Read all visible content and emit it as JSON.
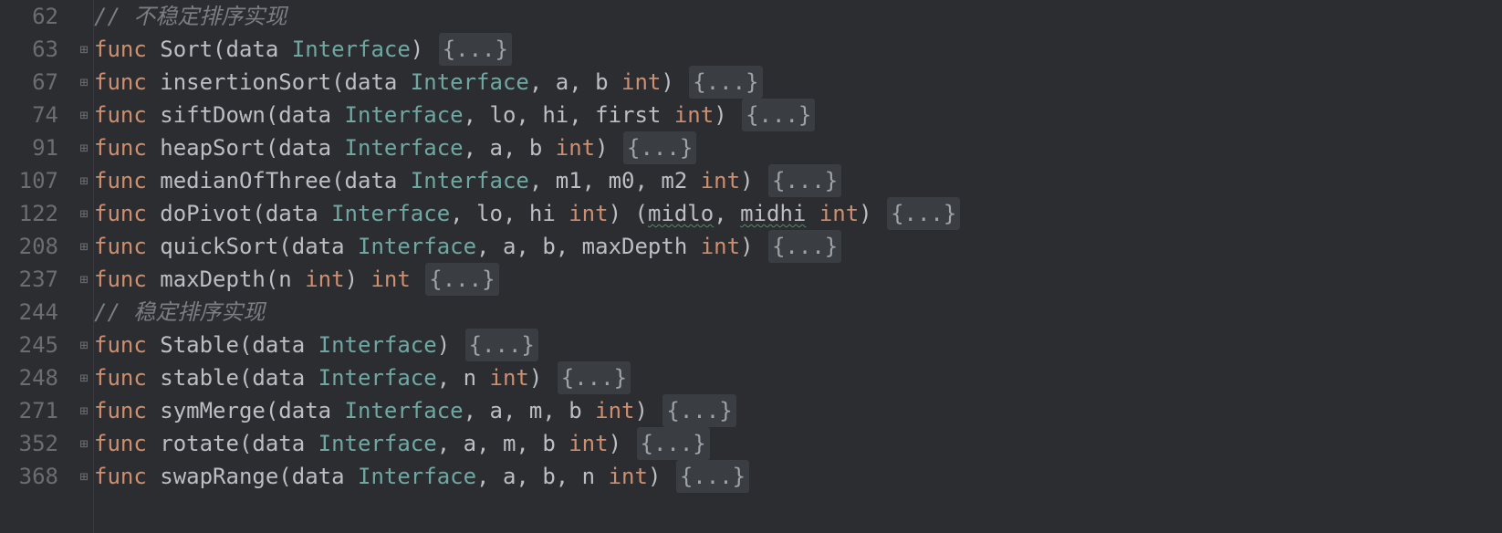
{
  "lines": [
    {
      "num": "62",
      "fold": "",
      "tokens": [
        {
          "cls": "tok-comment",
          "text": "// 不稳定排序实现"
        }
      ]
    },
    {
      "num": "63",
      "fold": "⊞",
      "tokens": [
        {
          "cls": "tok-keyword",
          "text": "func"
        },
        {
          "cls": "tok-default",
          "text": " "
        },
        {
          "cls": "tok-func-name",
          "text": "Sort"
        },
        {
          "cls": "tok-punct",
          "text": "("
        },
        {
          "cls": "tok-param",
          "text": "data"
        },
        {
          "cls": "tok-default",
          "text": " "
        },
        {
          "cls": "tok-type",
          "text": "Interface"
        },
        {
          "cls": "tok-punct",
          "text": ") "
        },
        {
          "cls": "fold-placeholder",
          "text": "{...}"
        }
      ]
    },
    {
      "num": "67",
      "fold": "⊞",
      "tokens": [
        {
          "cls": "tok-keyword",
          "text": "func"
        },
        {
          "cls": "tok-default",
          "text": " "
        },
        {
          "cls": "tok-func-name",
          "text": "insertionSort"
        },
        {
          "cls": "tok-punct",
          "text": "("
        },
        {
          "cls": "tok-param",
          "text": "data"
        },
        {
          "cls": "tok-default",
          "text": " "
        },
        {
          "cls": "tok-type",
          "text": "Interface"
        },
        {
          "cls": "tok-punct",
          "text": ", "
        },
        {
          "cls": "tok-param",
          "text": "a"
        },
        {
          "cls": "tok-punct",
          "text": ", "
        },
        {
          "cls": "tok-param",
          "text": "b"
        },
        {
          "cls": "tok-default",
          "text": " "
        },
        {
          "cls": "tok-keyword",
          "text": "int"
        },
        {
          "cls": "tok-punct",
          "text": ") "
        },
        {
          "cls": "fold-placeholder",
          "text": "{...}"
        }
      ]
    },
    {
      "num": "74",
      "fold": "⊞",
      "tokens": [
        {
          "cls": "tok-keyword",
          "text": "func"
        },
        {
          "cls": "tok-default",
          "text": " "
        },
        {
          "cls": "tok-func-name",
          "text": "siftDown"
        },
        {
          "cls": "tok-punct",
          "text": "("
        },
        {
          "cls": "tok-param",
          "text": "data"
        },
        {
          "cls": "tok-default",
          "text": " "
        },
        {
          "cls": "tok-type",
          "text": "Interface"
        },
        {
          "cls": "tok-punct",
          "text": ", "
        },
        {
          "cls": "tok-param",
          "text": "lo"
        },
        {
          "cls": "tok-punct",
          "text": ", "
        },
        {
          "cls": "tok-param",
          "text": "hi"
        },
        {
          "cls": "tok-punct",
          "text": ", "
        },
        {
          "cls": "tok-param",
          "text": "first"
        },
        {
          "cls": "tok-default",
          "text": " "
        },
        {
          "cls": "tok-keyword",
          "text": "int"
        },
        {
          "cls": "tok-punct",
          "text": ") "
        },
        {
          "cls": "fold-placeholder",
          "text": "{...}"
        }
      ]
    },
    {
      "num": "91",
      "fold": "⊞",
      "tokens": [
        {
          "cls": "tok-keyword",
          "text": "func"
        },
        {
          "cls": "tok-default",
          "text": " "
        },
        {
          "cls": "tok-func-name",
          "text": "heapSort"
        },
        {
          "cls": "tok-punct",
          "text": "("
        },
        {
          "cls": "tok-param",
          "text": "data"
        },
        {
          "cls": "tok-default",
          "text": " "
        },
        {
          "cls": "tok-type",
          "text": "Interface"
        },
        {
          "cls": "tok-punct",
          "text": ", "
        },
        {
          "cls": "tok-param",
          "text": "a"
        },
        {
          "cls": "tok-punct",
          "text": ", "
        },
        {
          "cls": "tok-param",
          "text": "b"
        },
        {
          "cls": "tok-default",
          "text": " "
        },
        {
          "cls": "tok-keyword",
          "text": "int"
        },
        {
          "cls": "tok-punct",
          "text": ") "
        },
        {
          "cls": "fold-placeholder",
          "text": "{...}"
        }
      ]
    },
    {
      "num": "107",
      "fold": "⊞",
      "tokens": [
        {
          "cls": "tok-keyword",
          "text": "func"
        },
        {
          "cls": "tok-default",
          "text": " "
        },
        {
          "cls": "tok-func-name",
          "text": "medianOfThree"
        },
        {
          "cls": "tok-punct",
          "text": "("
        },
        {
          "cls": "tok-param",
          "text": "data"
        },
        {
          "cls": "tok-default",
          "text": " "
        },
        {
          "cls": "tok-type",
          "text": "Interface"
        },
        {
          "cls": "tok-punct",
          "text": ", "
        },
        {
          "cls": "tok-param",
          "text": "m1"
        },
        {
          "cls": "tok-punct",
          "text": ", "
        },
        {
          "cls": "tok-param",
          "text": "m0"
        },
        {
          "cls": "tok-punct",
          "text": ", "
        },
        {
          "cls": "tok-param",
          "text": "m2"
        },
        {
          "cls": "tok-default",
          "text": " "
        },
        {
          "cls": "tok-keyword",
          "text": "int"
        },
        {
          "cls": "tok-punct",
          "text": ") "
        },
        {
          "cls": "fold-placeholder",
          "text": "{...}"
        }
      ]
    },
    {
      "num": "122",
      "fold": "⊞",
      "tokens": [
        {
          "cls": "tok-keyword",
          "text": "func"
        },
        {
          "cls": "tok-default",
          "text": " "
        },
        {
          "cls": "tok-func-name",
          "text": "doPivot"
        },
        {
          "cls": "tok-punct",
          "text": "("
        },
        {
          "cls": "tok-param",
          "text": "data"
        },
        {
          "cls": "tok-default",
          "text": " "
        },
        {
          "cls": "tok-type",
          "text": "Interface"
        },
        {
          "cls": "tok-punct",
          "text": ", "
        },
        {
          "cls": "tok-param",
          "text": "lo"
        },
        {
          "cls": "tok-punct",
          "text": ", "
        },
        {
          "cls": "tok-param",
          "text": "hi"
        },
        {
          "cls": "tok-default",
          "text": " "
        },
        {
          "cls": "tok-keyword",
          "text": "int"
        },
        {
          "cls": "tok-punct",
          "text": ") ("
        },
        {
          "cls": "tok-named-return",
          "text": "midlo"
        },
        {
          "cls": "tok-punct",
          "text": ", "
        },
        {
          "cls": "tok-named-return",
          "text": "midhi"
        },
        {
          "cls": "tok-default",
          "text": " "
        },
        {
          "cls": "tok-keyword",
          "text": "int"
        },
        {
          "cls": "tok-punct",
          "text": ") "
        },
        {
          "cls": "fold-placeholder",
          "text": "{...}"
        }
      ]
    },
    {
      "num": "208",
      "fold": "⊞",
      "tokens": [
        {
          "cls": "tok-keyword",
          "text": "func"
        },
        {
          "cls": "tok-default",
          "text": " "
        },
        {
          "cls": "tok-func-name",
          "text": "quickSort"
        },
        {
          "cls": "tok-punct",
          "text": "("
        },
        {
          "cls": "tok-param",
          "text": "data"
        },
        {
          "cls": "tok-default",
          "text": " "
        },
        {
          "cls": "tok-type",
          "text": "Interface"
        },
        {
          "cls": "tok-punct",
          "text": ", "
        },
        {
          "cls": "tok-param",
          "text": "a"
        },
        {
          "cls": "tok-punct",
          "text": ", "
        },
        {
          "cls": "tok-param",
          "text": "b"
        },
        {
          "cls": "tok-punct",
          "text": ", "
        },
        {
          "cls": "tok-param",
          "text": "maxDepth"
        },
        {
          "cls": "tok-default",
          "text": " "
        },
        {
          "cls": "tok-keyword",
          "text": "int"
        },
        {
          "cls": "tok-punct",
          "text": ") "
        },
        {
          "cls": "fold-placeholder",
          "text": "{...}"
        }
      ]
    },
    {
      "num": "237",
      "fold": "⊞",
      "tokens": [
        {
          "cls": "tok-keyword",
          "text": "func"
        },
        {
          "cls": "tok-default",
          "text": " "
        },
        {
          "cls": "tok-func-name",
          "text": "maxDepth"
        },
        {
          "cls": "tok-punct",
          "text": "("
        },
        {
          "cls": "tok-param",
          "text": "n"
        },
        {
          "cls": "tok-default",
          "text": " "
        },
        {
          "cls": "tok-keyword",
          "text": "int"
        },
        {
          "cls": "tok-punct",
          "text": ") "
        },
        {
          "cls": "tok-keyword",
          "text": "int"
        },
        {
          "cls": "tok-default",
          "text": " "
        },
        {
          "cls": "fold-placeholder",
          "text": "{...}"
        }
      ]
    },
    {
      "num": "244",
      "fold": "",
      "tokens": [
        {
          "cls": "tok-comment",
          "text": "// 稳定排序实现"
        }
      ]
    },
    {
      "num": "245",
      "fold": "⊞",
      "tokens": [
        {
          "cls": "tok-keyword",
          "text": "func"
        },
        {
          "cls": "tok-default",
          "text": " "
        },
        {
          "cls": "tok-func-name",
          "text": "Stable"
        },
        {
          "cls": "tok-punct",
          "text": "("
        },
        {
          "cls": "tok-param",
          "text": "data"
        },
        {
          "cls": "tok-default",
          "text": " "
        },
        {
          "cls": "tok-type",
          "text": "Interface"
        },
        {
          "cls": "tok-punct",
          "text": ") "
        },
        {
          "cls": "fold-placeholder",
          "text": "{...}"
        }
      ]
    },
    {
      "num": "248",
      "fold": "⊞",
      "tokens": [
        {
          "cls": "tok-keyword",
          "text": "func"
        },
        {
          "cls": "tok-default",
          "text": " "
        },
        {
          "cls": "tok-func-name",
          "text": "stable"
        },
        {
          "cls": "tok-punct",
          "text": "("
        },
        {
          "cls": "tok-param",
          "text": "data"
        },
        {
          "cls": "tok-default",
          "text": " "
        },
        {
          "cls": "tok-type",
          "text": "Interface"
        },
        {
          "cls": "tok-punct",
          "text": ", "
        },
        {
          "cls": "tok-param",
          "text": "n"
        },
        {
          "cls": "tok-default",
          "text": " "
        },
        {
          "cls": "tok-keyword",
          "text": "int"
        },
        {
          "cls": "tok-punct",
          "text": ") "
        },
        {
          "cls": "fold-placeholder",
          "text": "{...}"
        }
      ]
    },
    {
      "num": "271",
      "fold": "⊞",
      "tokens": [
        {
          "cls": "tok-keyword",
          "text": "func"
        },
        {
          "cls": "tok-default",
          "text": " "
        },
        {
          "cls": "tok-func-name",
          "text": "symMerge"
        },
        {
          "cls": "tok-punct",
          "text": "("
        },
        {
          "cls": "tok-param",
          "text": "data"
        },
        {
          "cls": "tok-default",
          "text": " "
        },
        {
          "cls": "tok-type",
          "text": "Interface"
        },
        {
          "cls": "tok-punct",
          "text": ", "
        },
        {
          "cls": "tok-param",
          "text": "a"
        },
        {
          "cls": "tok-punct",
          "text": ", "
        },
        {
          "cls": "tok-param",
          "text": "m"
        },
        {
          "cls": "tok-punct",
          "text": ", "
        },
        {
          "cls": "tok-param",
          "text": "b"
        },
        {
          "cls": "tok-default",
          "text": " "
        },
        {
          "cls": "tok-keyword",
          "text": "int"
        },
        {
          "cls": "tok-punct",
          "text": ") "
        },
        {
          "cls": "fold-placeholder",
          "text": "{...}"
        }
      ]
    },
    {
      "num": "352",
      "fold": "⊞",
      "tokens": [
        {
          "cls": "tok-keyword",
          "text": "func"
        },
        {
          "cls": "tok-default",
          "text": " "
        },
        {
          "cls": "tok-func-name",
          "text": "rotate"
        },
        {
          "cls": "tok-punct",
          "text": "("
        },
        {
          "cls": "tok-param",
          "text": "data"
        },
        {
          "cls": "tok-default",
          "text": " "
        },
        {
          "cls": "tok-type",
          "text": "Interface"
        },
        {
          "cls": "tok-punct",
          "text": ", "
        },
        {
          "cls": "tok-param",
          "text": "a"
        },
        {
          "cls": "tok-punct",
          "text": ", "
        },
        {
          "cls": "tok-param",
          "text": "m"
        },
        {
          "cls": "tok-punct",
          "text": ", "
        },
        {
          "cls": "tok-param",
          "text": "b"
        },
        {
          "cls": "tok-default",
          "text": " "
        },
        {
          "cls": "tok-keyword",
          "text": "int"
        },
        {
          "cls": "tok-punct",
          "text": ") "
        },
        {
          "cls": "fold-placeholder",
          "text": "{...}"
        }
      ]
    },
    {
      "num": "368",
      "fold": "⊞",
      "tokens": [
        {
          "cls": "tok-keyword",
          "text": "func"
        },
        {
          "cls": "tok-default",
          "text": " "
        },
        {
          "cls": "tok-func-name",
          "text": "swapRange"
        },
        {
          "cls": "tok-punct",
          "text": "("
        },
        {
          "cls": "tok-param",
          "text": "data"
        },
        {
          "cls": "tok-default",
          "text": " "
        },
        {
          "cls": "tok-type",
          "text": "Interface"
        },
        {
          "cls": "tok-punct",
          "text": ", "
        },
        {
          "cls": "tok-param",
          "text": "a"
        },
        {
          "cls": "tok-punct",
          "text": ", "
        },
        {
          "cls": "tok-param",
          "text": "b"
        },
        {
          "cls": "tok-punct",
          "text": ", "
        },
        {
          "cls": "tok-param",
          "text": "n"
        },
        {
          "cls": "tok-default",
          "text": " "
        },
        {
          "cls": "tok-keyword",
          "text": "int"
        },
        {
          "cls": "tok-punct",
          "text": ") "
        },
        {
          "cls": "fold-placeholder",
          "text": "{...}"
        }
      ]
    }
  ]
}
